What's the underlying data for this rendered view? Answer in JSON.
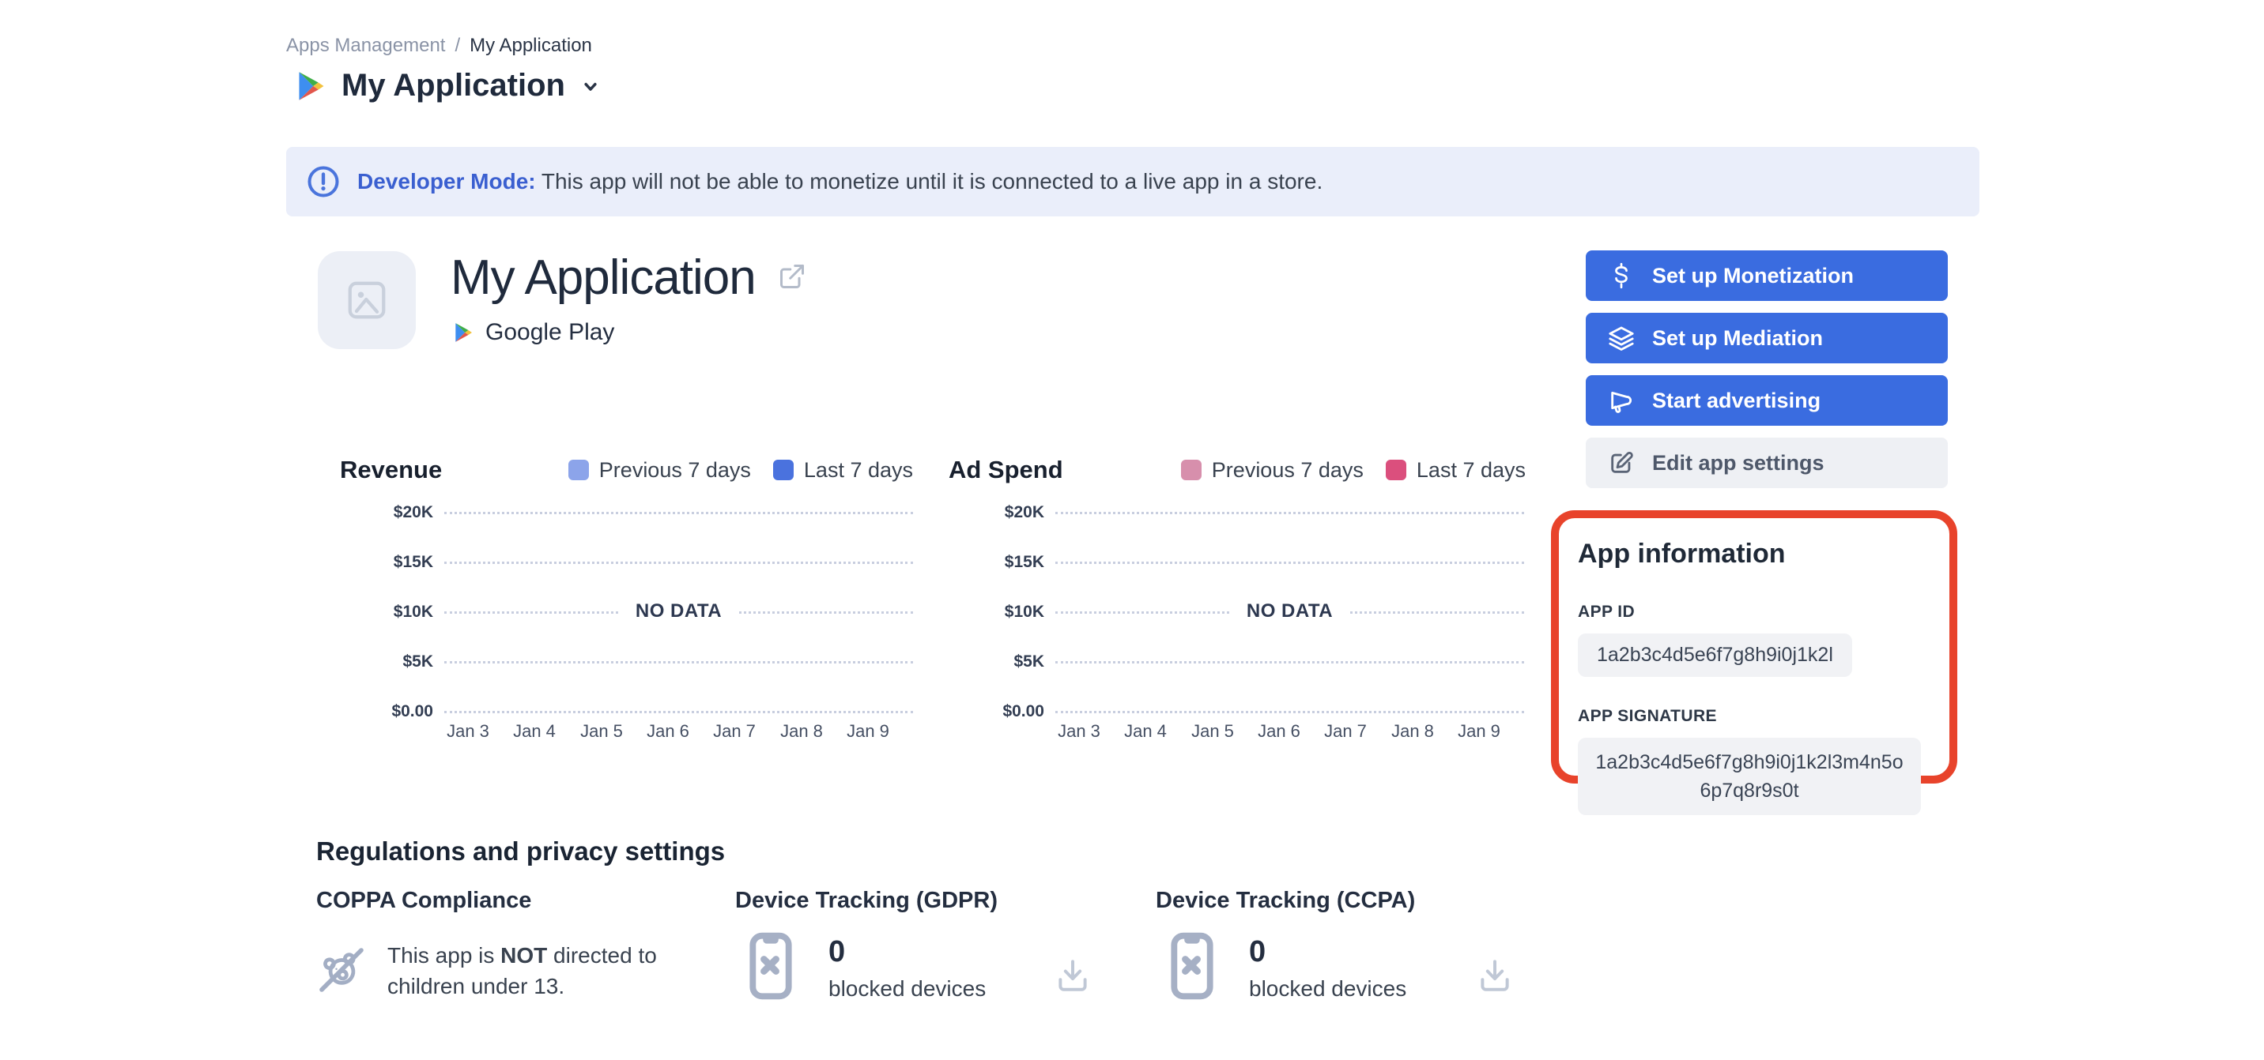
{
  "breadcrumb": {
    "parent": "Apps Management",
    "separator": "/",
    "current": "My Application"
  },
  "page": {
    "title": "My Application"
  },
  "banner": {
    "bold": "Developer Mode:",
    "text": " This app will not be able to monetize until it is connected to a live app in a store."
  },
  "hero": {
    "name": "My Application",
    "store": "Google Play"
  },
  "actions": [
    {
      "label": "Set up Monetization"
    },
    {
      "label": "Set up Mediation"
    },
    {
      "label": "Start advertising"
    },
    {
      "label": "Edit app settings"
    }
  ],
  "chart_data": [
    {
      "type": "line",
      "title": "Revenue",
      "series": [
        {
          "name": "Previous 7 days",
          "color": "#8CA4EA",
          "values": []
        },
        {
          "name": "Last 7 days",
          "color": "#4A72DE",
          "values": []
        }
      ],
      "categories": [
        "Jan 3",
        "Jan 4",
        "Jan 5",
        "Jan 6",
        "Jan 7",
        "Jan 8",
        "Jan 9"
      ],
      "yticks": [
        "$20K",
        "$15K",
        "$10K",
        "$5K",
        "$0.00"
      ],
      "ylim": [
        0,
        20000
      ],
      "grid": "horizontal-dotted",
      "legend_position": "top-right",
      "no_data_label": "NO DATA"
    },
    {
      "type": "line",
      "title": "Ad Spend",
      "series": [
        {
          "name": "Previous 7 days",
          "color": "#D78FAC",
          "values": []
        },
        {
          "name": "Last 7 days",
          "color": "#DB4F7D",
          "values": []
        }
      ],
      "categories": [
        "Jan 3",
        "Jan 4",
        "Jan 5",
        "Jan 6",
        "Jan 7",
        "Jan 8",
        "Jan 9"
      ],
      "yticks": [
        "$20K",
        "$15K",
        "$10K",
        "$5K",
        "$0.00"
      ],
      "ylim": [
        0,
        20000
      ],
      "grid": "horizontal-dotted",
      "legend_position": "top-right",
      "no_data_label": "NO DATA"
    }
  ],
  "app_info": {
    "heading": "App information",
    "app_id_label": "APP ID",
    "app_id_value": "1a2b3c4d5e6f7g8h9i0j1k2l",
    "app_signature_label": "APP SIGNATURE",
    "app_signature_value": "1a2b3c4d5e6f7g8h9i0j1k2l3m4n5o6p7q8r9s0t",
    "highlight_color": "#E8432B"
  },
  "regulations": {
    "heading": "Regulations and privacy settings",
    "coppa": {
      "title": "COPPA Compliance",
      "text_prefix": "This app is ",
      "text_bold": "NOT",
      "text_suffix": " directed to children under 13."
    },
    "gdpr": {
      "title": "Device Tracking (GDPR)",
      "count": "0",
      "label": "blocked devices"
    },
    "ccpa": {
      "title": "Device Tracking (CCPA)",
      "count": "0",
      "label": "blocked devices"
    }
  },
  "colors": {
    "primary_button": "#3A6CE0",
    "banner_background": "#EAEEFA",
    "banner_accent": "#3A5FD0",
    "highlight_red": "#E8432B",
    "chip_background": "#F1F2F5"
  }
}
